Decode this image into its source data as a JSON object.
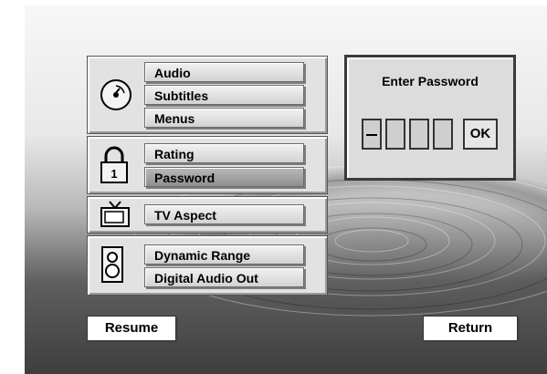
{
  "menu": {
    "groups": [
      {
        "icon": "disc-icon",
        "items": [
          "Audio",
          "Subtitles",
          "Menus"
        ]
      },
      {
        "icon": "padlock-icon",
        "items": [
          "Rating",
          "Password"
        ]
      },
      {
        "icon": "tv-icon",
        "items": [
          "TV Aspect"
        ]
      },
      {
        "icon": "speaker-icon",
        "items": [
          "Dynamic Range",
          "Digital Audio Out"
        ]
      }
    ],
    "selected": "Password"
  },
  "password_dialog": {
    "title": "Enter Password",
    "ok_label": "OK"
  },
  "bottom": {
    "resume_label": "Resume",
    "return_label": "Return"
  }
}
